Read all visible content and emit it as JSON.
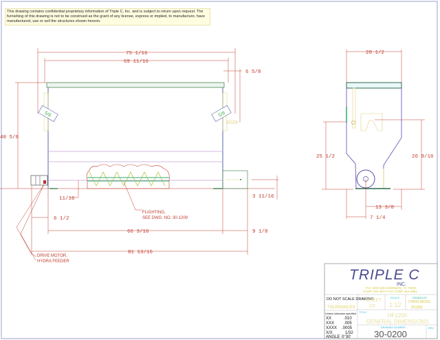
{
  "notice": "This drawing contains confidential proprietary information of Triple C, Inc. and is subject to return upon request.  The furnishing of this drawing is not to be construed as the grant of any license, express or implied, to manufacture, have manufactured, use or sell the structures shown hereon.",
  "front_view": {
    "dims": {
      "overall_top": "75 1/16",
      "inner_top": "69 11/16",
      "right_offset": "6 5/8",
      "height": "40 5/8",
      "auger_offset": "11/16",
      "right_box_height": "3 11/16",
      "motor_offset": "6 1/2",
      "body_length": "66 3/16",
      "right_box_length": "9 1/8",
      "overall_length": "81 13/16"
    },
    "labels": {
      "left_tag": "5/8",
      "right_tag": "5/8",
      "flighting_line1": "FLIGHTING,",
      "flighting_line2": "SEE DWG. NO. 30-1209",
      "motor_line1": "DRIVE MOTOR,",
      "motor_line2": "HYDRA FEEDER"
    }
  },
  "side_view": {
    "dims": {
      "width": "20 1/2",
      "left_height": "25 1/2",
      "right_height": "26 9/16",
      "right_offset": "13 3/8",
      "left_offset": "7 1/4"
    }
  },
  "title_block": {
    "company": "TRIPLE C",
    "company_suffix": "INC.",
    "address_line1": "P.O. BOX 508   SHERMAN, TX 75091",
    "address_line2": "CORP. 254-3874    FAX CORP. 254-3881",
    "do_not_scale": "DO NOT SCALE DRAWING",
    "tolerances_label": "TOLERANCES",
    "sheet_label": "SHEET",
    "sheet_of": "OF",
    "scale_label": "SCALE",
    "scale_value": "1:12",
    "drawn_by_label": "DRAWN BY",
    "drawn_by": "CHRIS MOSS",
    "date": "9/13/06",
    "unless_specified": "Unless otherwise specified",
    "tolerances": [
      {
        "key": "XX",
        "value": ".010"
      },
      {
        "key": "XXX",
        "value": ".005"
      },
      {
        "key": "XXXX",
        "value": ".0005"
      },
      {
        "key": "X/X",
        "value": "1/32"
      },
      {
        "key": "ANGLE",
        "value": "0°30'"
      }
    ],
    "title_label": "TITLE",
    "title_line1": "HF1200",
    "title_line2": "GENERAL DIMENSIONS",
    "drawing_number_label": "DRAWING NUMBER",
    "drawing_number": "30-0200",
    "rev_label": "REV"
  }
}
